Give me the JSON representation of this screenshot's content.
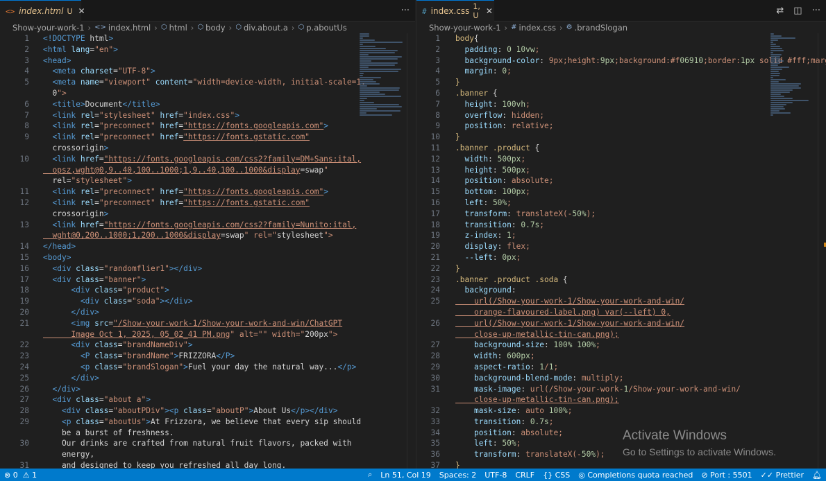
{
  "left": {
    "tab": {
      "icon": "<>",
      "name": "index.html",
      "status": "U"
    },
    "breadcrumb": [
      "Show-your-work-1",
      "index.html",
      "html",
      "body",
      "div.about.a",
      "p.aboutUs"
    ],
    "more_label": "···",
    "lines": [
      {
        "n": "1",
        "t": "<!DOCTYPE html>"
      },
      {
        "n": "2",
        "t": "<html lang=\"en\">"
      },
      {
        "n": "3",
        "t": "<head>"
      },
      {
        "n": "4",
        "t": "  <meta charset=\"UTF-8\">"
      },
      {
        "n": "5",
        "t": "  <meta name=\"viewport\" content=\"width=device-width, initial-scale=1."
      },
      {
        "n": "",
        "t": "  0\">"
      },
      {
        "n": "6",
        "t": "  <title>Document</title>"
      },
      {
        "n": "7",
        "t": "  <link rel=\"stylesheet\" href=\"index.css\">"
      },
      {
        "n": "8",
        "t": "  <link rel=\"preconnect\" href=\"https://fonts.googleapis.com\">"
      },
      {
        "n": "9",
        "t": "  <link rel=\"preconnect\" href=\"https://fonts.gstatic.com\""
      },
      {
        "n": "",
        "t": "  crossorigin>"
      },
      {
        "n": "10",
        "t": "  <link href=\"https://fonts.googleapis.com/css2?family=DM+Sans:ital,"
      },
      {
        "n": "",
        "t": "  opsz,wght@0,9..40,100..1000;1,9..40,100..1000&display=swap\""
      },
      {
        "n": "",
        "t": "  rel=\"stylesheet\">"
      },
      {
        "n": "11",
        "t": "  <link rel=\"preconnect\" href=\"https://fonts.googleapis.com\">"
      },
      {
        "n": "12",
        "t": "  <link rel=\"preconnect\" href=\"https://fonts.gstatic.com\""
      },
      {
        "n": "",
        "t": "  crossorigin>"
      },
      {
        "n": "13",
        "t": "  <link href=\"https://fonts.googleapis.com/css2?family=Nunito:ital,"
      },
      {
        "n": "",
        "t": "  wght@0,200..1000;1,200..1000&display=swap\" rel=\"stylesheet\">"
      },
      {
        "n": "14",
        "t": "</head>"
      },
      {
        "n": "15",
        "t": "<body>"
      },
      {
        "n": "16",
        "t": "  <div class=\"randomflier1\"></div>"
      },
      {
        "n": "17",
        "t": "  <div class=\"banner\">"
      },
      {
        "n": "18",
        "t": "      <div class=\"product\">"
      },
      {
        "n": "19",
        "t": "        <div class=\"soda\"></div>"
      },
      {
        "n": "20",
        "t": "      </div>"
      },
      {
        "n": "21",
        "t": "      <img src=\"/Show-your-work-1/Show-your-work-and-win/ChatGPT"
      },
      {
        "n": "",
        "t": "      Image Oct 1, 2025, 05_02_41 PM.png\" alt=\"\" width=\"200px\">"
      },
      {
        "n": "22",
        "t": "      <div class=\"brandNameDiv\">"
      },
      {
        "n": "23",
        "t": "        <P class=\"brandName\">FRIZZORA</P>"
      },
      {
        "n": "24",
        "t": "        <p class=\"brandSlogan\">Fuel your day the natural way...</p>"
      },
      {
        "n": "25",
        "t": "      </div>"
      },
      {
        "n": "26",
        "t": "  </div>"
      },
      {
        "n": "27",
        "t": "  <div class=\"about a\">"
      },
      {
        "n": "28",
        "t": "    <div class=\"aboutPDiv\"><p class=\"aboutP\">About Us</p></div>"
      },
      {
        "n": "29",
        "t": "    <p class=\"aboutUs\">At Frizzora, we believe that every sip should"
      },
      {
        "n": "",
        "t": "    be a burst of freshness."
      },
      {
        "n": "30",
        "t": "    Our drinks are crafted from natural fruit flavors, packed with"
      },
      {
        "n": "",
        "t": "    energy,"
      },
      {
        "n": "31",
        "t": "    and designed to keep you refreshed all day long."
      }
    ]
  },
  "right": {
    "tab": {
      "icon": "#",
      "name": "index.css",
      "status": "1, U"
    },
    "breadcrumb": [
      "Show-your-work-1",
      "index.css",
      ".brandSlogan"
    ],
    "lines": [
      {
        "n": "1",
        "t": "body{"
      },
      {
        "n": "2",
        "t": "  padding: 0 10vw;"
      },
      {
        "n": "3",
        "t": "  background-color: ■ rgb(240, 105, 16);"
      },
      {
        "n": "4",
        "t": "  margin: 0;"
      },
      {
        "n": "5",
        "t": "}"
      },
      {
        "n": "6",
        "t": ".banner {"
      },
      {
        "n": "7",
        "t": "  height: 100vh;"
      },
      {
        "n": "8",
        "t": "  overflow: hidden;"
      },
      {
        "n": "9",
        "t": "  position: relative;"
      },
      {
        "n": "10",
        "t": "}"
      },
      {
        "n": "11",
        "t": ".banner .product {"
      },
      {
        "n": "12",
        "t": "  width: 500px;"
      },
      {
        "n": "13",
        "t": "  height: 500px;"
      },
      {
        "n": "14",
        "t": "  position: absolute;"
      },
      {
        "n": "15",
        "t": "  bottom: 100px;"
      },
      {
        "n": "16",
        "t": "  left: 50%;"
      },
      {
        "n": "17",
        "t": "  transform: translateX(-50%);"
      },
      {
        "n": "18",
        "t": "  transition: 0.7s;"
      },
      {
        "n": "19",
        "t": "  z-index: 1;"
      },
      {
        "n": "20",
        "t": "  display: flex;"
      },
      {
        "n": "21",
        "t": "  --left: 0px;"
      },
      {
        "n": "22",
        "t": "}"
      },
      {
        "n": "23",
        "t": ".banner .product .soda {"
      },
      {
        "n": "24",
        "t": "  background:"
      },
      {
        "n": "25",
        "t": "    url(/Show-your-work-1/Show-your-work-and-win/"
      },
      {
        "n": "",
        "t": "    orange-flavoured-label.png) var(--left) 0,"
      },
      {
        "n": "26",
        "t": "    url(/Show-your-work-1/Show-your-work-and-win/"
      },
      {
        "n": "",
        "t": "    close-up-metallic-tin-can.png);"
      },
      {
        "n": "27",
        "t": "    background-size: 100% 100%;"
      },
      {
        "n": "28",
        "t": "    width: 600px;"
      },
      {
        "n": "29",
        "t": "    aspect-ratio: 1/1;"
      },
      {
        "n": "30",
        "t": "    background-blend-mode: multiply;"
      },
      {
        "n": "31",
        "t": "    mask-image: url(/Show-your-work-1/Show-your-work-and-win/"
      },
      {
        "n": "",
        "t": "    close-up-metallic-tin-can.png);"
      },
      {
        "n": "32",
        "t": "    mask-size: auto 100%;"
      },
      {
        "n": "33",
        "t": "    transition: 0.7s;"
      },
      {
        "n": "34",
        "t": "    position: absolute;"
      },
      {
        "n": "35",
        "t": "    left: 50%;"
      },
      {
        "n": "36",
        "t": "    transform: translateX(-50%);"
      },
      {
        "n": "37",
        "t": "}"
      }
    ]
  },
  "colors": {
    "tag": "#569cd6",
    "attr": "#9cdcfe",
    "string": "#ce9178",
    "text": "#d4d4d4",
    "selector": "#d7ba7d",
    "prop": "#9cdcfe",
    "number": "#b5cea8",
    "swatch": "#f06910",
    "accent": "#007acc"
  },
  "watermark": {
    "title": "Activate Windows",
    "subtitle": "Go to Settings to activate Windows."
  },
  "status": {
    "errors": "0",
    "warnings": "1",
    "position": "Ln 51, Col 19",
    "spaces": "Spaces: 2",
    "encoding": "UTF-8",
    "eol": "CRLF",
    "language": "CSS",
    "copilot": "Completions quota reached",
    "port": "Port : 5501",
    "prettier": "Prettier"
  }
}
